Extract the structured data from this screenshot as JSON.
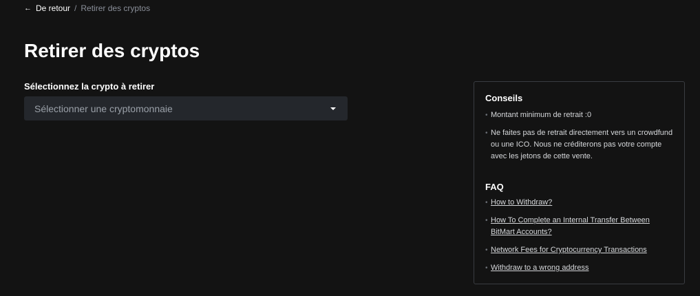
{
  "breadcrumb": {
    "back_label": "De retour",
    "separator": "/",
    "current": "Retirer des cryptos"
  },
  "page": {
    "title": "Retirer des cryptos"
  },
  "form": {
    "label": "Sélectionnez la crypto à retirer",
    "select_placeholder": "Sélectionner une cryptomonnaie"
  },
  "tips": {
    "heading": "Conseils",
    "items": [
      "Montant minimum de retrait :0",
      "Ne faites pas de retrait directement vers un crowdfund ou une ICO. Nous ne créditerons pas votre compte avec les jetons de cette vente."
    ]
  },
  "faq": {
    "heading": "FAQ",
    "links": [
      "How to Withdraw?",
      "How To Complete an Internal Transfer Between BitMart Accounts?",
      "Network Fees for Cryptocurrency Transactions",
      "Withdraw to a wrong address"
    ]
  },
  "icons": {
    "back": "arrow-left-icon",
    "select_caret": "caret-down-icon",
    "bullet": "bullet-icon"
  },
  "colors": {
    "background": "#131313",
    "select_background": "#24272c",
    "panel_border": "#3a3d42",
    "muted_text": "#8a8f99"
  }
}
